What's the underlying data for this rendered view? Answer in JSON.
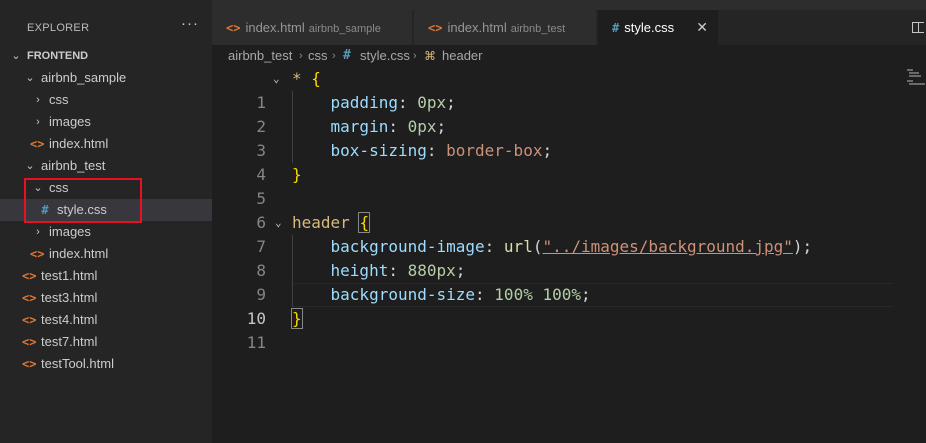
{
  "explorer": {
    "title": "EXPLORER",
    "more_label": "···",
    "tree": [
      {
        "label": "FRONTEND",
        "kind": "root",
        "chevron": "⌄"
      },
      {
        "label": "airbnb_sample",
        "kind": "folder",
        "chevron": "⌄"
      },
      {
        "label": "css",
        "kind": "folder",
        "chevron": "›"
      },
      {
        "label": "images",
        "kind": "folder",
        "chevron": "›"
      },
      {
        "label": "index.html",
        "kind": "html",
        "icon": "<>"
      },
      {
        "label": "airbnb_test",
        "kind": "folder",
        "chevron": "⌄"
      },
      {
        "label": "css",
        "kind": "folder",
        "chevron": "⌄"
      },
      {
        "label": "style.css",
        "kind": "css",
        "icon": "#"
      },
      {
        "label": "images",
        "kind": "folder",
        "chevron": "›"
      },
      {
        "label": "index.html",
        "kind": "html",
        "icon": "<>"
      },
      {
        "label": "test1.html",
        "kind": "html",
        "icon": "<>"
      },
      {
        "label": "test3.html",
        "kind": "html",
        "icon": "<>"
      },
      {
        "label": "test4.html",
        "kind": "html",
        "icon": "<>"
      },
      {
        "label": "test7.html",
        "kind": "html",
        "icon": "<>"
      },
      {
        "label": "testTool.html",
        "kind": "html",
        "icon": "<>"
      }
    ]
  },
  "tabs": [
    {
      "label": "index.html",
      "description": "airbnb_sample",
      "icon": "<>"
    },
    {
      "label": "index.html",
      "description": "airbnb_test",
      "icon": "<>"
    },
    {
      "label": "style.css",
      "description": "",
      "icon": "#",
      "close": "✕"
    }
  ],
  "breadcrumb": {
    "folder": "airbnb_test",
    "sub": "css",
    "file_icon": "#",
    "file": "style.css",
    "symbol": "header"
  },
  "editor": {
    "active_line": 10,
    "line_numbers": [
      "1",
      "2",
      "3",
      "4",
      "5",
      "6",
      "7",
      "8",
      "9",
      "10",
      "11"
    ],
    "code": {
      "l1_sel": "*",
      "l1_brace": "{",
      "l2_prop": "padding",
      "l2_val": "0px",
      "l3_prop": "margin",
      "l3_val": "0px",
      "l4_prop": "box-sizing",
      "l4_val": "border-box",
      "l5_brace": "}",
      "l7_sel": "header",
      "l7_brace": "{",
      "l8_prop": "background-image",
      "l8_fn": "url",
      "l8_str": "\"../images/background.jpg\"",
      "l9_prop": "height",
      "l9_val": "880px",
      "l10_prop": "background-size",
      "l10_val": "100% 100%",
      "l11_brace": "}"
    }
  },
  "colors": {
    "selection_highlight": "#e81123",
    "html_icon": "#e37933",
    "css_icon": "#519aba"
  }
}
